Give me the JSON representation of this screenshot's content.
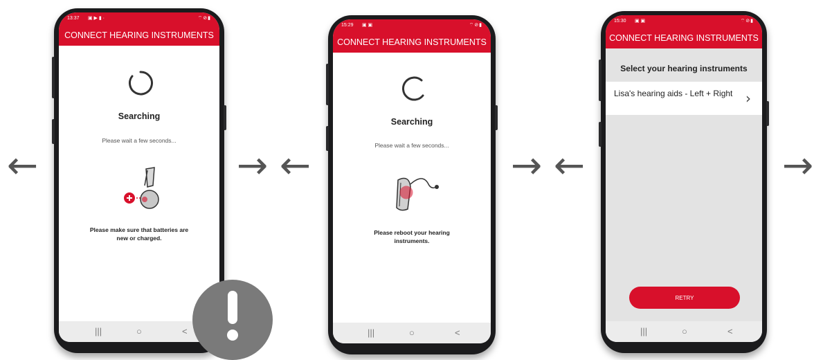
{
  "colors": {
    "accent": "#d8102b",
    "warning_badge": "#7a7a7a"
  },
  "screens": [
    {
      "status_time": "13:37",
      "status_icons": "▣ ▶ ▮ ·",
      "status_right": "⌔⊘▮",
      "title": "CONNECT HEARING INSTRUMENTS",
      "heading": "Searching",
      "subtitle": "Please wait a few seconds...",
      "hint_line1": "Please make sure that batteries are",
      "hint_line2": "new or charged.",
      "nav": {
        "recents": "|||",
        "home": "○",
        "back": "<"
      }
    },
    {
      "status_time": "15:29",
      "status_icons": "▣ ▣",
      "status_right": "⌔⊘▮",
      "title": "CONNECT HEARING INSTRUMENTS",
      "heading": "Searching",
      "subtitle": "Please wait a few seconds...",
      "hint_line1": "Please reboot your hearing",
      "hint_line2": "instruments.",
      "nav": {
        "recents": "|||",
        "home": "○",
        "back": "<"
      }
    },
    {
      "status_time": "15:30",
      "status_icons": "▣ ▣",
      "status_right": "⌔⊘▮",
      "title": "CONNECT HEARING INSTRUMENTS",
      "list_header": "Select your hearing instruments",
      "item_label": "Lisa's hearing aids - Left + Right",
      "retry": "RETRY",
      "nav": {
        "recents": "|||",
        "home": "○",
        "back": "<"
      }
    }
  ],
  "arrows": {
    "back": "←",
    "forward": "→"
  },
  "icons": [
    "loading-spinner-icon",
    "battery-hearing-aid-icon",
    "reboot-hearing-aid-icon",
    "chevron-right-icon",
    "exclamation-icon"
  ]
}
